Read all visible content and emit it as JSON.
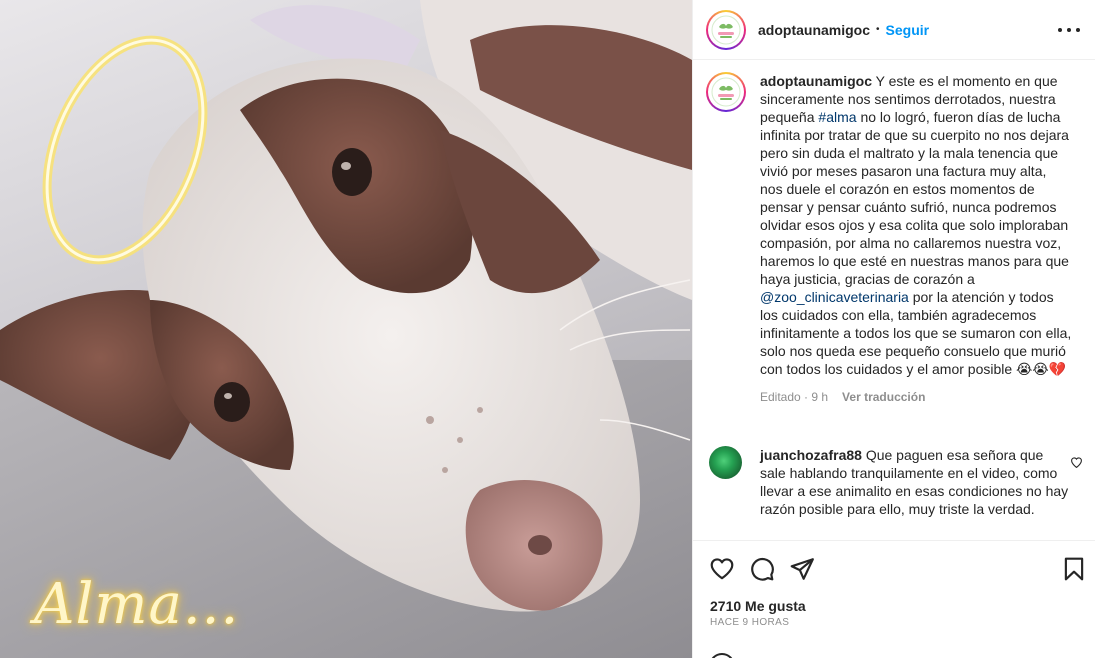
{
  "post": {
    "username": "adoptaunamigoc",
    "follow_label": "Seguir",
    "separator": "•",
    "photo_overlay_text": "Alma...",
    "caption": {
      "username": "adoptaunamigoc",
      "text_part1": "Y este es el momento en que sinceramente nos sentimos derrotados, nuestra pequeña",
      "hashtag": "#alma",
      "text_part2": "no lo logró, fueron días de lucha infinita por tratar de que su cuerpito no nos dejara pero sin duda el maltrato y la mala tenencia que vivió por meses pasaron una factura muy alta, nos duele el corazón en estos momentos de pensar y pensar cuánto sufrió, nunca podremos olvidar esos ojos y esa colita que solo imploraban compasión, por alma no callaremos nuestra voz, haremos lo que esté en nuestras manos para que haya justicia, gracias de corazón a",
      "mention": "@zoo_clinicaveterinaria",
      "text_part3": "por la atención y todos los cuidados con ella, también agradecemos infinitamente a todos los que se sumaron con ella, solo nos queda ese pequeño consuelo que murió con todos los cuidados y el amor posible 😭😭💔",
      "edited_label": "Editado · 9 h",
      "translate_label": "Ver traducción"
    },
    "comment": {
      "username": "juanchozafra88",
      "text": "Que paguen esa señora que sale hablando tranquilamente en el video, como llevar a ese animalito en esas condiciones no hay razón posible para ello, muy triste la verdad."
    },
    "likes_label": "2710 Me gusta",
    "time_label": "HACE 9 HORAS",
    "icons": [
      "heart-icon",
      "comment-icon",
      "share-icon",
      "save-icon",
      "more-icon"
    ],
    "colors": {
      "follow": "#0095f6",
      "link": "#00376b",
      "muted": "#8e8e8e",
      "text": "#262626"
    }
  }
}
